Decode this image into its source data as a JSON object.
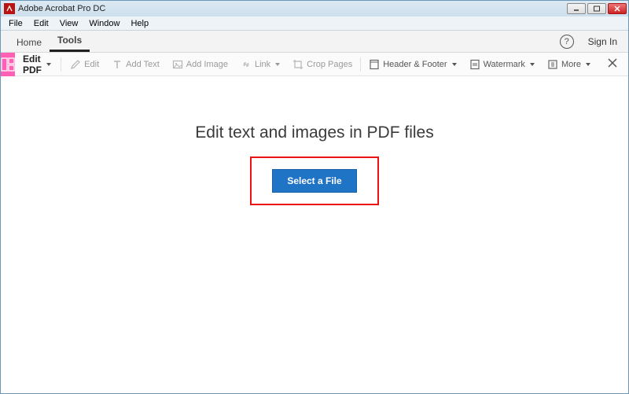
{
  "window": {
    "title": "Adobe Acrobat Pro DC"
  },
  "menubar": [
    "File",
    "Edit",
    "View",
    "Window",
    "Help"
  ],
  "tabs": {
    "home": "Home",
    "tools": "Tools",
    "signin": "Sign In"
  },
  "toolbar": {
    "feature": "Edit PDF",
    "tools": {
      "edit": "Edit",
      "addText": "Add Text",
      "addImage": "Add Image",
      "link": "Link",
      "crop": "Crop Pages",
      "headerFooter": "Header & Footer",
      "watermark": "Watermark",
      "more": "More"
    }
  },
  "content": {
    "headline": "Edit text and images in PDF files",
    "cta": "Select a File"
  }
}
